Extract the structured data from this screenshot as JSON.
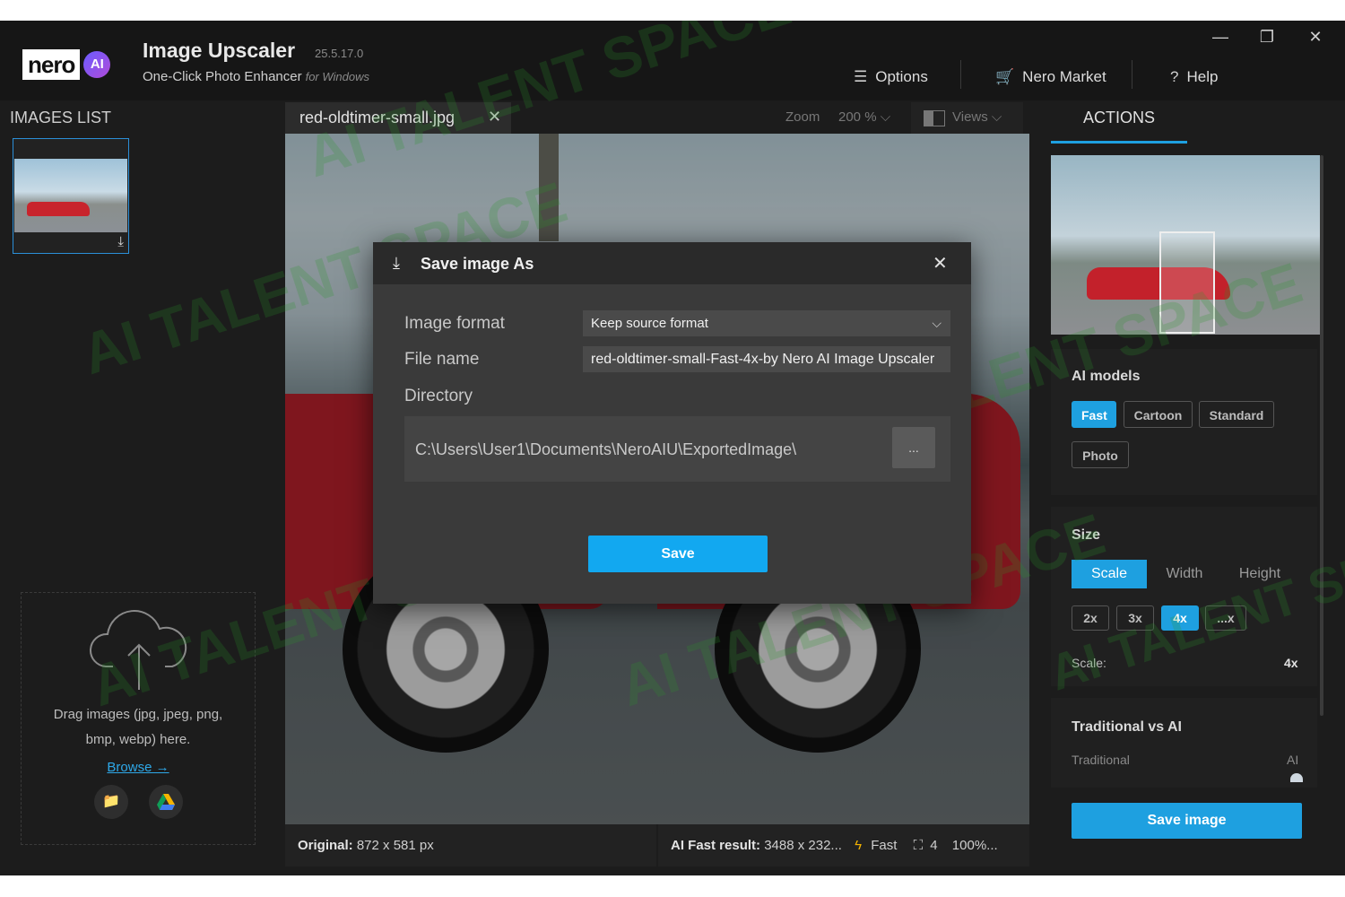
{
  "app": {
    "title": "Image Upscaler",
    "version": "25.5.17.0",
    "subtitle": "One-Click Photo Enhancer",
    "subtitle_for": "for Windows",
    "logo_text": "nero",
    "logo_ai": "AI"
  },
  "topnav": {
    "options": "Options",
    "market": "Nero Market",
    "help": "Help",
    "help_icon": "?"
  },
  "window_controls": {
    "minimize": "—",
    "restore": "❐",
    "close": "✕"
  },
  "images_list": {
    "title": "IMAGES LIST",
    "drop_text_line1": "Drag images (jpg, jpeg, png,",
    "drop_text_line2": "bmp, webp) here.",
    "browse": "Browse →"
  },
  "tabbar": {
    "file_name": "red-oldtimer-small.jpg",
    "zoom_label": "Zoom",
    "zoom_value": "200 %",
    "views": "Views"
  },
  "status": {
    "original_label": "Original:",
    "original_value": "872 x 581 px",
    "result_label": "AI Fast result:",
    "result_value": "3488 x 232...",
    "model": "Fast",
    "scale": "4",
    "percent": "100%..."
  },
  "actions": {
    "tab": "ACTIONS",
    "ai_models_title": "AI models",
    "models": [
      "Fast",
      "Cartoon",
      "Standard",
      "Photo"
    ],
    "active_model": "Fast",
    "size_title": "Size",
    "size_tabs": [
      "Scale",
      "Width",
      "Height"
    ],
    "scales": [
      "2x",
      "3x",
      "4x",
      "...x"
    ],
    "scale_label": "Scale:",
    "scale_value": "4x",
    "trad_title": "Traditional vs AI",
    "trad_left": "Traditional",
    "trad_right": "AI",
    "save_image": "Save image"
  },
  "dialog": {
    "title": "Save image As",
    "format_label": "Image format",
    "format_value": "Keep source format",
    "filename_label": "File name",
    "filename_value": "red-oldtimer-small-Fast-4x-by Nero AI Image Upscaler",
    "directory_label": "Directory",
    "directory_value": "C:\\Users\\User1\\Documents\\NeroAIU\\ExportedImage\\",
    "browse_button": "...",
    "save_button": "Save"
  },
  "watermark": "AI TALENT SPACE",
  "colors": {
    "accent": "#1ea0e0",
    "dialog_save": "#12a8f0",
    "panel": "#1c1c1c"
  }
}
